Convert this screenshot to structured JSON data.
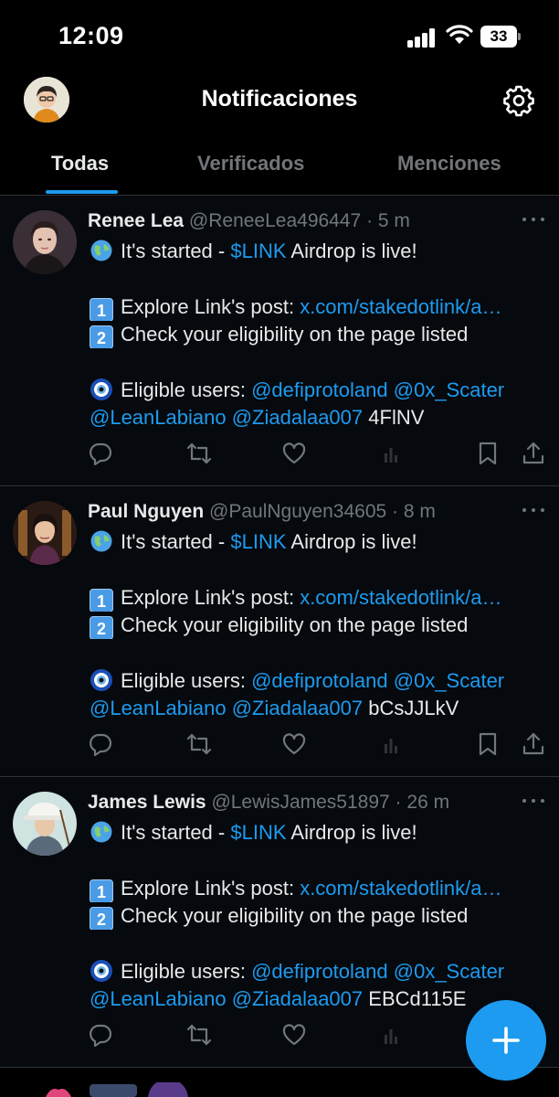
{
  "status_bar": {
    "time": "12:09",
    "battery": "33"
  },
  "header": {
    "title": "Notificaciones"
  },
  "tabs": [
    {
      "label": "Todas",
      "active": true
    },
    {
      "label": "Verificados",
      "active": false
    },
    {
      "label": "Menciones",
      "active": false
    }
  ],
  "posts": [
    {
      "name": "Renee Lea",
      "handle": "@ReneeLea496447",
      "sep": "·",
      "time": "5 m",
      "line1_pre": "It's started - ",
      "line1_link": "$LINK",
      "line1_post": " Airdrop is live!",
      "step1_num": "1",
      "step1_text": "Explore Link's post: ",
      "step1_link": "x.com/stakedotlink/a…",
      "step2_num": "2",
      "step2_text": "Check your eligibility on the page listed",
      "eligible_text": "Eligible users: ",
      "mention1": "@defiprotoland",
      "mention2": "@0x_Scater",
      "mention3": "@LeanLabiano",
      "mention4": "@Ziadalaa007",
      "code": "4FlNV"
    },
    {
      "name": "Paul Nguyen",
      "handle": "@PaulNguyen34605",
      "sep": "·",
      "time": "8 m",
      "line1_pre": "It's started - ",
      "line1_link": "$LINK",
      "line1_post": " Airdrop is live!",
      "step1_num": "1",
      "step1_text": "Explore Link's post: ",
      "step1_link": "x.com/stakedotlink/a…",
      "step2_num": "2",
      "step2_text": "Check your eligibility on the page listed",
      "eligible_text": "Eligible users: ",
      "mention1": "@defiprotoland",
      "mention2": "@0x_Scater",
      "mention3": "@LeanLabiano",
      "mention4": "@Ziadalaa007",
      "code": "bCsJJLkV"
    },
    {
      "name": "James Lewis",
      "handle": "@LewisJames51897",
      "sep": "·",
      "time": "26 m",
      "line1_pre": "It's started - ",
      "line1_link": "$LINK",
      "line1_post": " Airdrop is live!",
      "step1_num": "1",
      "step1_text": "Explore Link's post: ",
      "step1_link": "x.com/stakedotlink/a…",
      "step2_num": "2",
      "step2_text": "Check your eligibility on the page listed",
      "eligible_text": "Eligible users: ",
      "mention1": "@defiprotoland",
      "mention2": "@0x_Scater",
      "mention3": "@LeanLabiano",
      "mention4": "@Ziadalaa007",
      "code": "EBCd115E"
    }
  ],
  "icons": {
    "status": [
      "signal-icon",
      "wifi-icon",
      "battery-icon"
    ],
    "header": [
      "profile-avatar",
      "settings-gear-icon"
    ],
    "post_actions": [
      "reply-icon",
      "repost-icon",
      "like-icon",
      "views-icon",
      "bookmark-icon",
      "share-icon"
    ],
    "emojis": [
      "globe-emoji",
      "keycap-1-emoji",
      "keycap-2-emoji",
      "nazar-amulet-emoji"
    ],
    "fab": "compose-plus-icon"
  },
  "colors": {
    "background": "#000000",
    "text": "#e7e9ea",
    "muted": "#71767b",
    "accent": "#1d9bf0",
    "divider": "#2f3336"
  }
}
